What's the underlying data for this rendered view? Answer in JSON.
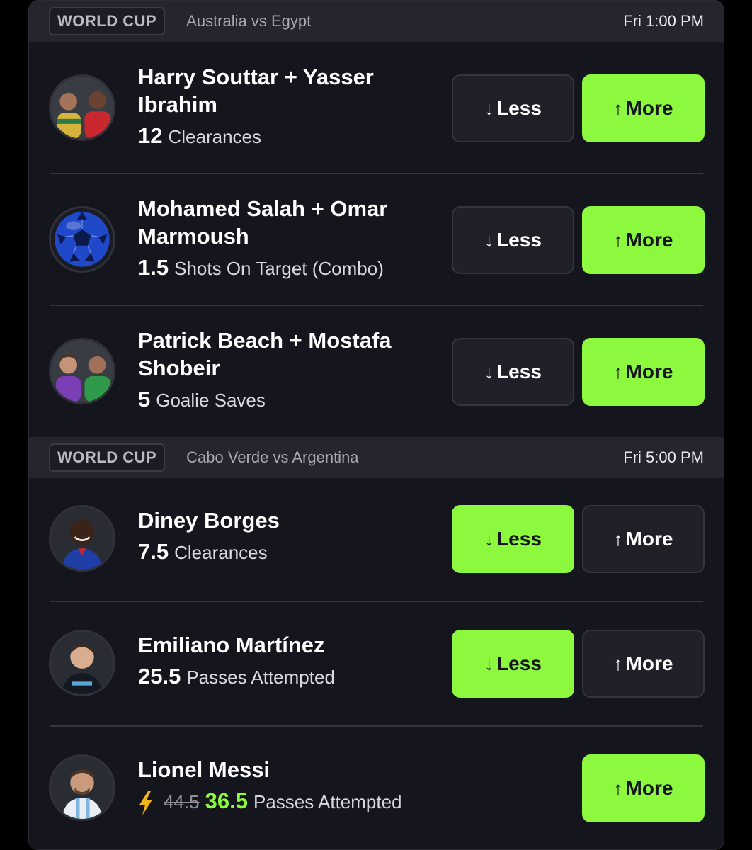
{
  "groups": [
    {
      "badge": "WORLD CUP",
      "match": "Australia vs Egypt",
      "time": "Fri 1:00 PM",
      "picks": [
        {
          "name": "Harry Souttar + Yasser Ibrahim",
          "line": "12",
          "stat": "Clearances",
          "avatar_icon": "two-players-avatar-icon",
          "selected": "more",
          "less_label": "Less",
          "more_label": "More"
        },
        {
          "name": "Mohamed Salah + Omar Marmoush",
          "line": "1.5",
          "stat": "Shots On Target (Combo)",
          "avatar_icon": "soccer-ball-icon",
          "selected": "more",
          "less_label": "Less",
          "more_label": "More"
        },
        {
          "name": "Patrick Beach + Mostafa Shobeir",
          "line": "5",
          "stat": "Goalie Saves",
          "avatar_icon": "two-players-avatar-icon",
          "selected": "more",
          "less_label": "Less",
          "more_label": "More"
        }
      ]
    },
    {
      "badge": "WORLD CUP",
      "match": "Cabo Verde vs Argentina",
      "time": "Fri 5:00 PM",
      "picks": [
        {
          "name": "Diney Borges",
          "line": "7.5",
          "stat": "Clearances",
          "avatar_icon": "player-avatar-icon",
          "selected": "less",
          "less_label": "Less",
          "more_label": "More"
        },
        {
          "name": "Emiliano Martínez",
          "line": "25.5",
          "stat": "Passes Attempted",
          "avatar_icon": "player-avatar-icon",
          "selected": "less",
          "less_label": "Less",
          "more_label": "More"
        },
        {
          "name": "Lionel Messi",
          "old_line": "44.5",
          "line": "36.5",
          "stat": "Passes Attempted",
          "avatar_icon": "player-avatar-icon",
          "boost_icon": "lightning-bolt-icon",
          "selected": "more",
          "more_label": "More"
        }
      ]
    }
  ],
  "colors": {
    "accent": "#8cf83e",
    "panel": "#15161d",
    "header": "#24252d",
    "button_dark": "#1f2028"
  }
}
